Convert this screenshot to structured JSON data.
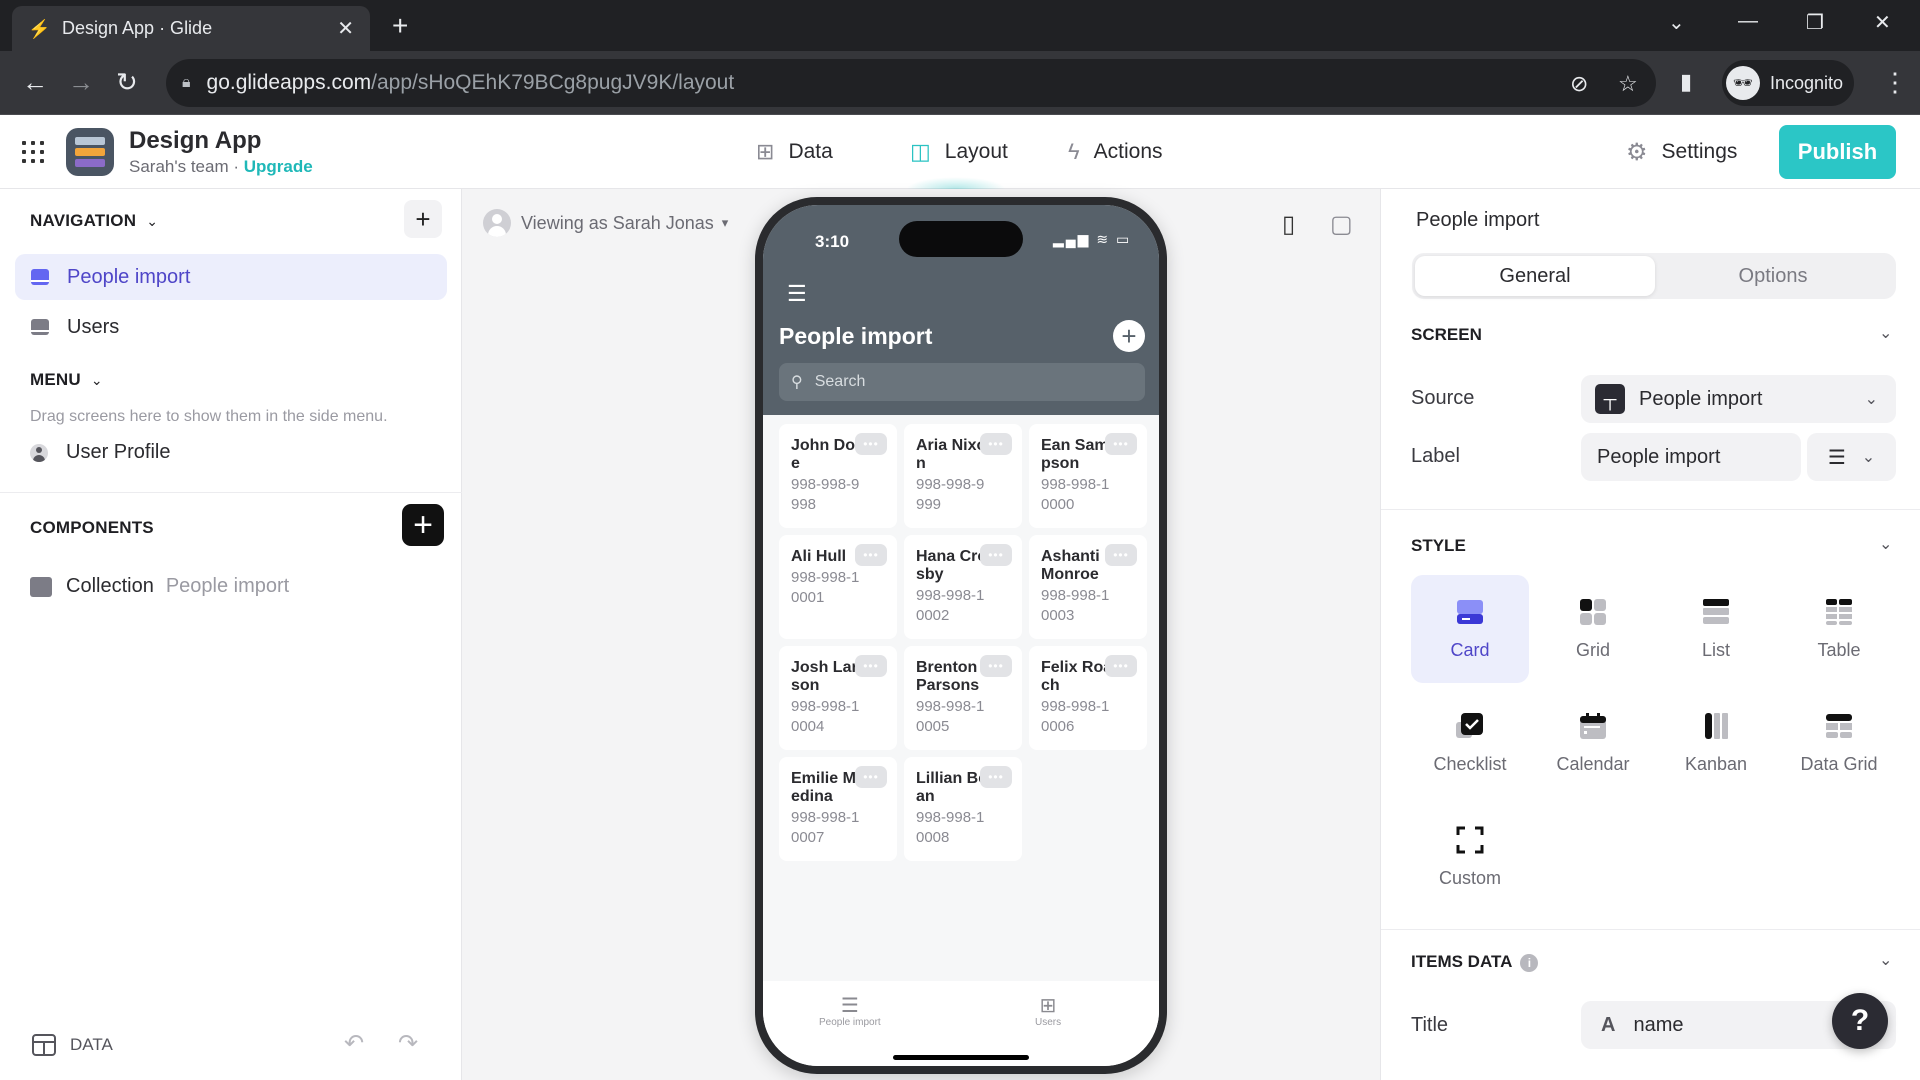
{
  "browser": {
    "tab_title": "Design App · Glide",
    "url_host": "go.glideapps.com",
    "url_path": "/app/sHoQEhK79BCg8pugJV9K/layout",
    "profile_label": "Incognito"
  },
  "header": {
    "app_name": "Design App",
    "team": "Sarah's team",
    "separator": " · ",
    "upgrade": "Upgrade",
    "nav": [
      {
        "label": "Data",
        "icon": "table-icon"
      },
      {
        "label": "Layout",
        "icon": "layout-icon",
        "active": true
      },
      {
        "label": "Actions",
        "icon": "lightning-icon"
      }
    ],
    "settings_label": "Settings",
    "publish_label": "Publish",
    "accent_color": "#2bc6c6"
  },
  "sidebar": {
    "navigation_title": "NAVIGATION",
    "navigation_items": [
      {
        "label": "People import",
        "selected": true
      },
      {
        "label": "Users",
        "selected": false
      }
    ],
    "menu_title": "MENU",
    "menu_hint": "Drag screens here to show them in the side menu.",
    "menu_items": [
      {
        "label": "User Profile"
      }
    ],
    "components_title": "COMPONENTS",
    "components": [
      {
        "label": "Collection",
        "source": "People import"
      }
    ],
    "data_label": "DATA"
  },
  "canvas": {
    "viewing_as": "Viewing as Sarah Jonas",
    "phone": {
      "time": "3:10",
      "screen_title": "People import",
      "search_placeholder": "Search",
      "cards": [
        {
          "name": "John Doe",
          "phone": "998-998-9998"
        },
        {
          "name": "Aria Nixon",
          "phone": "998-998-9999"
        },
        {
          "name": "Ean Sampson",
          "phone": "998-998-10000"
        },
        {
          "name": "Ali Hull",
          "phone": "998-998-10001"
        },
        {
          "name": "Hana Crosby",
          "phone": "998-998-10002"
        },
        {
          "name": "Ashanti Monroe",
          "phone": "998-998-10003"
        },
        {
          "name": "Josh Larson",
          "phone": "998-998-10004"
        },
        {
          "name": "Brenton Parsons",
          "phone": "998-998-10005"
        },
        {
          "name": "Felix Roach",
          "phone": "998-998-10006"
        },
        {
          "name": "Emilie Medina",
          "phone": "998-998-10007"
        },
        {
          "name": "Lillian Bean",
          "phone": "998-998-10008"
        }
      ],
      "tabs": [
        {
          "label": "People import",
          "icon": "list-icon"
        },
        {
          "label": "Users",
          "icon": "grid-icon"
        }
      ]
    }
  },
  "panel": {
    "title": "People import",
    "tabs": [
      {
        "label": "General",
        "active": true
      },
      {
        "label": "Options",
        "active": false
      }
    ],
    "screen_section": "SCREEN",
    "source_label": "Source",
    "source_value": "People import",
    "label_label": "Label",
    "label_value": "People import",
    "style_section": "STYLE",
    "styles": [
      {
        "label": "Card",
        "selected": true
      },
      {
        "label": "Grid"
      },
      {
        "label": "List"
      },
      {
        "label": "Table"
      },
      {
        "label": "Checklist"
      },
      {
        "label": "Calendar"
      },
      {
        "label": "Kanban"
      },
      {
        "label": "Data Grid"
      },
      {
        "label": "Custom"
      }
    ],
    "items_data_section": "ITEMS DATA",
    "title_label": "Title",
    "title_value": "name",
    "title_type_glyph": "A",
    "help_label": "?"
  }
}
